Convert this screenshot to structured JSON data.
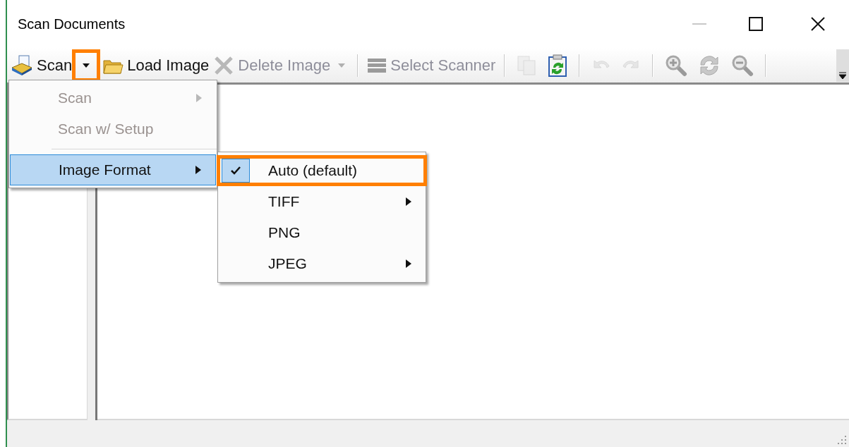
{
  "window": {
    "title": "Scan Documents"
  },
  "toolbar": [
    {
      "kind": "scan",
      "label": "Scan",
      "disabled": false
    },
    {
      "kind": "split",
      "disabled": false,
      "highlighted": true
    },
    {
      "kind": "load",
      "label": "Load Image",
      "disabled": false
    },
    {
      "kind": "delete",
      "label": "Delete Image",
      "disabled": true
    },
    {
      "kind": "split",
      "disabled": true,
      "highlighted": false
    },
    {
      "kind": "separator"
    },
    {
      "kind": "scanner",
      "label": "Select Scanner",
      "disabled": true
    },
    {
      "kind": "separator"
    },
    {
      "kind": "copy",
      "disabled": true
    },
    {
      "kind": "paste",
      "disabled": false
    },
    {
      "kind": "separator"
    },
    {
      "kind": "undo",
      "disabled": true
    },
    {
      "kind": "redo",
      "disabled": true
    },
    {
      "kind": "separator"
    },
    {
      "kind": "zoomin",
      "disabled": false
    },
    {
      "kind": "rotate",
      "disabled": false
    },
    {
      "kind": "zoomout",
      "disabled": false
    },
    {
      "kind": "separator"
    }
  ],
  "scan_menu": [
    {
      "kind": "item",
      "label": "Scan",
      "disabled": true,
      "submenu": true,
      "selected": false
    },
    {
      "kind": "item",
      "label": "Scan w/ Setup",
      "disabled": true,
      "submenu": false,
      "selected": false
    },
    {
      "kind": "separator"
    },
    {
      "kind": "item",
      "label": "Image Format",
      "disabled": false,
      "submenu": true,
      "selected": true
    }
  ],
  "image_format_menu": [
    {
      "label": "Auto (default)",
      "checked": true,
      "submenu": false,
      "highlighted": true
    },
    {
      "label": "TIFF",
      "checked": false,
      "submenu": true,
      "highlighted": false
    },
    {
      "label": "PNG",
      "checked": false,
      "submenu": false,
      "highlighted": false
    },
    {
      "label": "JPEG",
      "checked": false,
      "submenu": true,
      "highlighted": false
    }
  ]
}
